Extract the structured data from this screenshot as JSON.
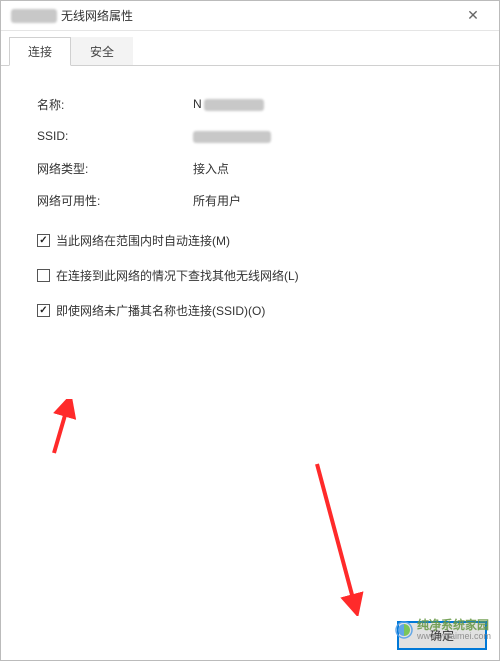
{
  "window": {
    "title_suffix": " 无线网络属性",
    "close_glyph": "✕"
  },
  "tabs": [
    {
      "label": "连接",
      "active": true
    },
    {
      "label": "安全",
      "active": false
    }
  ],
  "fields": {
    "name_label": "名称:",
    "name_value_prefix": "N",
    "ssid_label": "SSID:",
    "network_type_label": "网络类型:",
    "network_type_value": "接入点",
    "availability_label": "网络可用性:",
    "availability_value": "所有用户"
  },
  "checkboxes": {
    "auto_connect": {
      "checked": true,
      "label": "当此网络在范围内时自动连接(M)"
    },
    "find_other": {
      "checked": false,
      "label": "在连接到此网络的情况下查找其他无线网络(L)"
    },
    "hidden_ssid": {
      "checked": true,
      "label": "即使网络未广播其名称也连接(SSID)(O)"
    }
  },
  "buttons": {
    "ok": "确定"
  },
  "watermark": {
    "cn": "纯净系统家园",
    "url": "www.yidaimei.com"
  }
}
